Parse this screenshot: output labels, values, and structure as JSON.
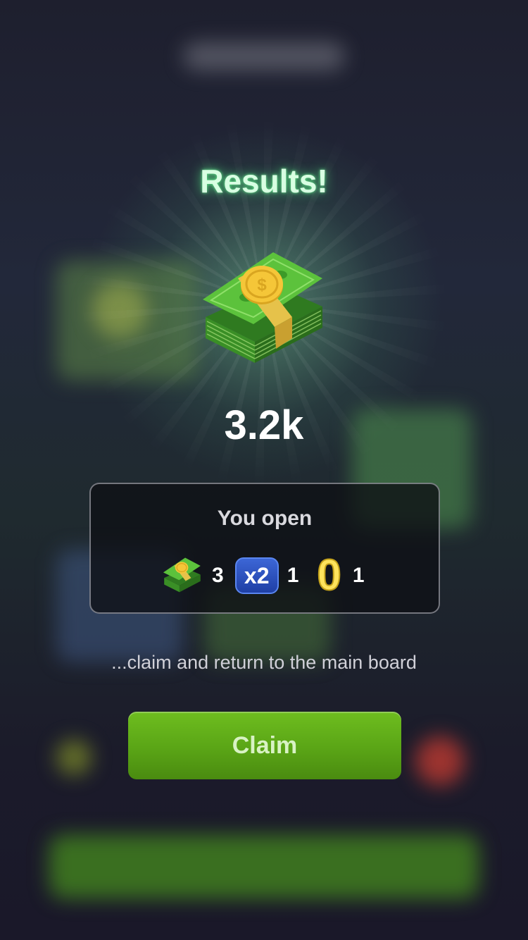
{
  "results": {
    "title": "Results!",
    "reward_icon": "money-stack-icon",
    "amount": "3.2k"
  },
  "panel": {
    "title": "You open",
    "items": [
      {
        "icon": "money-stack-icon",
        "count": "3"
      },
      {
        "icon": "x2-multiplier-icon",
        "label": "x2",
        "count": "1"
      },
      {
        "icon": "zero-icon",
        "label": "0",
        "count": "1"
      }
    ]
  },
  "hint": "...claim and return to the main board",
  "claim_button": {
    "label": "Claim"
  },
  "colors": {
    "title_glow": "#5aff8c",
    "button_green": "#5aa516",
    "multiplier_blue": "#2a4fc0",
    "zero_yellow": "#ffe45c"
  }
}
